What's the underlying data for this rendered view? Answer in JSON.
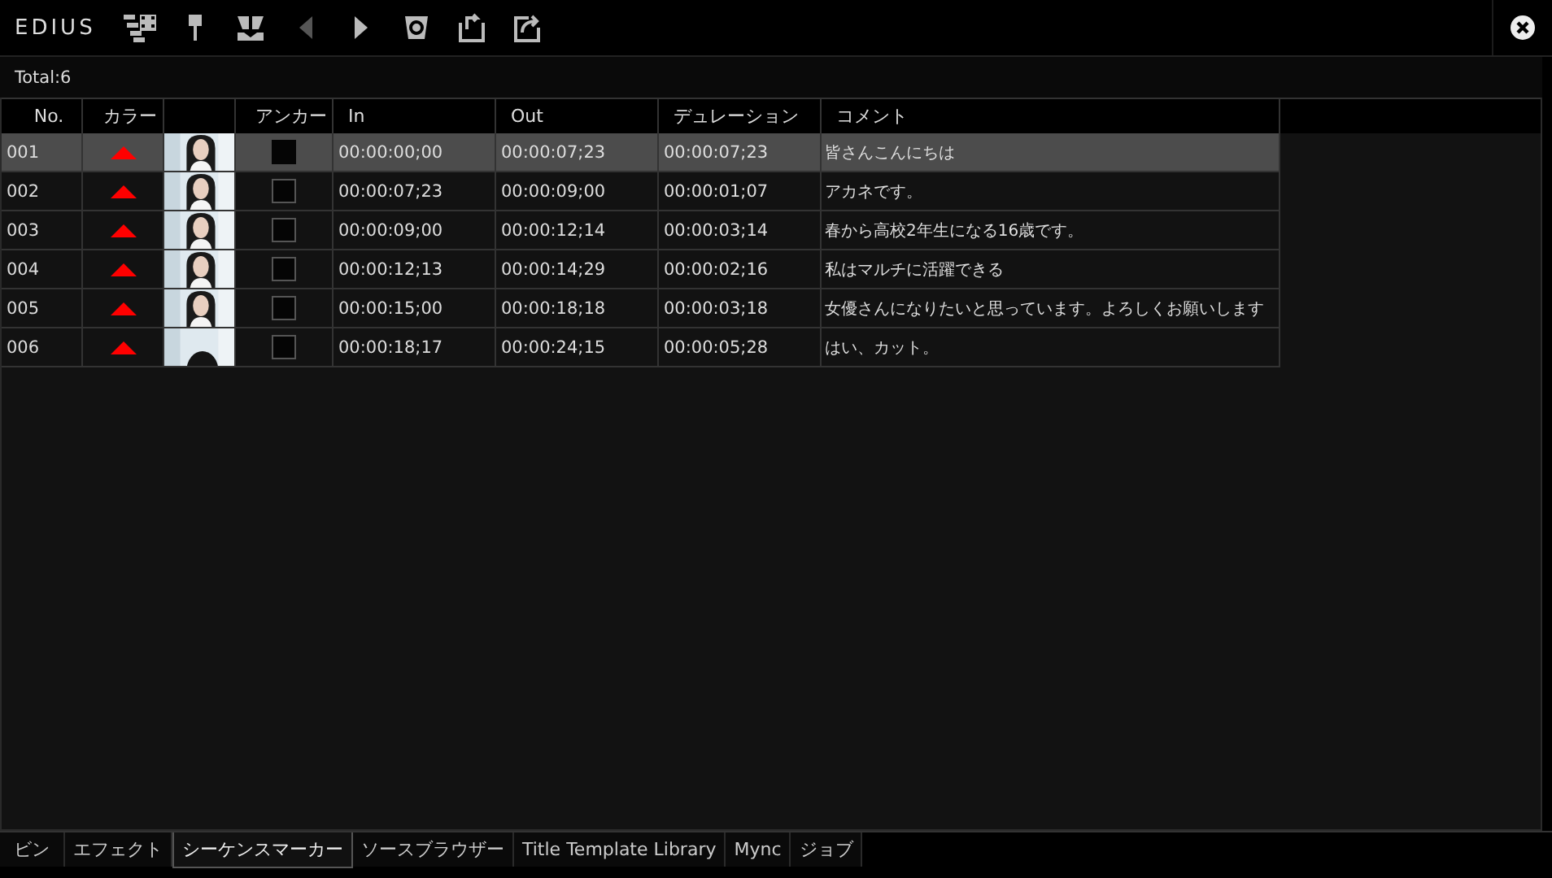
{
  "app": {
    "logo": "EDIUS"
  },
  "status": {
    "total": "Total:6"
  },
  "table": {
    "columns": [
      "No.",
      "カラー",
      "",
      "アンカー",
      "In",
      "Out",
      "デュレーション",
      "コメント"
    ],
    "rows": [
      {
        "no": "001",
        "color": "#ff0000",
        "anchor": true,
        "in": "00:00:00;00",
        "out": "00:00:07;23",
        "duration": "00:00:07;23",
        "comment": "皆さんこんにちは",
        "selected": true
      },
      {
        "no": "002",
        "color": "#ff0000",
        "anchor": false,
        "in": "00:00:07;23",
        "out": "00:00:09;00",
        "duration": "00:00:01;07",
        "comment": "アカネです。",
        "selected": false
      },
      {
        "no": "003",
        "color": "#ff0000",
        "anchor": false,
        "in": "00:00:09;00",
        "out": "00:00:12;14",
        "duration": "00:00:03;14",
        "comment": "春から高校2年生になる16歳です。",
        "selected": false
      },
      {
        "no": "004",
        "color": "#ff0000",
        "anchor": false,
        "in": "00:00:12;13",
        "out": "00:00:14;29",
        "duration": "00:00:02;16",
        "comment": "私はマルチに活躍できる",
        "selected": false
      },
      {
        "no": "005",
        "color": "#ff0000",
        "anchor": false,
        "in": "00:00:15;00",
        "out": "00:00:18;18",
        "duration": "00:00:03;18",
        "comment": "女優さんになりたいと思っています。よろしくお願いします",
        "selected": false
      },
      {
        "no": "006",
        "color": "#ff0000",
        "anchor": false,
        "in": "00:00:18;17",
        "out": "00:00:24;15",
        "duration": "00:00:05;28",
        "comment": "はい、カット。",
        "selected": false
      }
    ]
  },
  "tabs": [
    {
      "label": "ビン",
      "selected": false
    },
    {
      "label": "エフェクト",
      "selected": false
    },
    {
      "label": "シーケンスマーカー",
      "selected": true
    },
    {
      "label": "ソースブラウザー",
      "selected": false
    },
    {
      "label": "Title Template Library",
      "selected": false
    },
    {
      "label": "Mync",
      "selected": false
    },
    {
      "label": "ジョブ",
      "selected": false
    }
  ]
}
